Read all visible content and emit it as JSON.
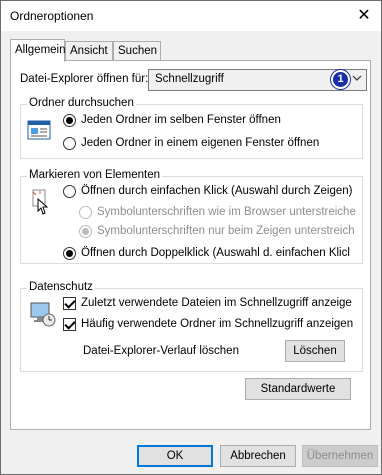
{
  "window": {
    "title": "Ordneroptionen",
    "close_glyph": "✕"
  },
  "tabs": [
    {
      "label": "Allgemein",
      "active": true
    },
    {
      "label": "Ansicht",
      "active": false
    },
    {
      "label": "Suchen",
      "active": false
    }
  ],
  "explorer_open": {
    "label": "Datei-Explorer öffnen für:",
    "selected": "Schnellzugriff",
    "badge": "1"
  },
  "browse_folders": {
    "title": "Ordner durchsuchen",
    "options": [
      {
        "label": "Jeden Ordner im selben Fenster öffnen",
        "checked": true
      },
      {
        "label": "Jeden Ordner in einem eigenen Fenster öffnen",
        "checked": false
      }
    ]
  },
  "click_items": {
    "title": "Markieren von Elementen",
    "single_click": "Öffnen durch einfachen Klick (Auswahl durch Zeigen)",
    "underline_browser": "Symbolunterschriften wie im Browser unterstreiche",
    "underline_hover": "Symbolunterschriften nur beim Zeigen unterstreich",
    "double_click": "Öffnen durch Doppelklick (Auswahl d. einfachen Klicl"
  },
  "privacy": {
    "title": "Datenschutz",
    "recent_files": "Zuletzt verwendete Dateien im Schnellzugriff anzeige",
    "frequent_folders": "Häufig verwendete Ordner im Schnellzugriff anzeigen",
    "clear_history_label": "Datei-Explorer-Verlauf löschen",
    "clear_button": "Löschen"
  },
  "defaults_button": "Standardwerte",
  "footer": {
    "ok": "OK",
    "cancel": "Abbrechen",
    "apply": "Übernehmen"
  },
  "colors": {
    "badge": "#1a2ea6",
    "primary_border": "#0078d7"
  }
}
